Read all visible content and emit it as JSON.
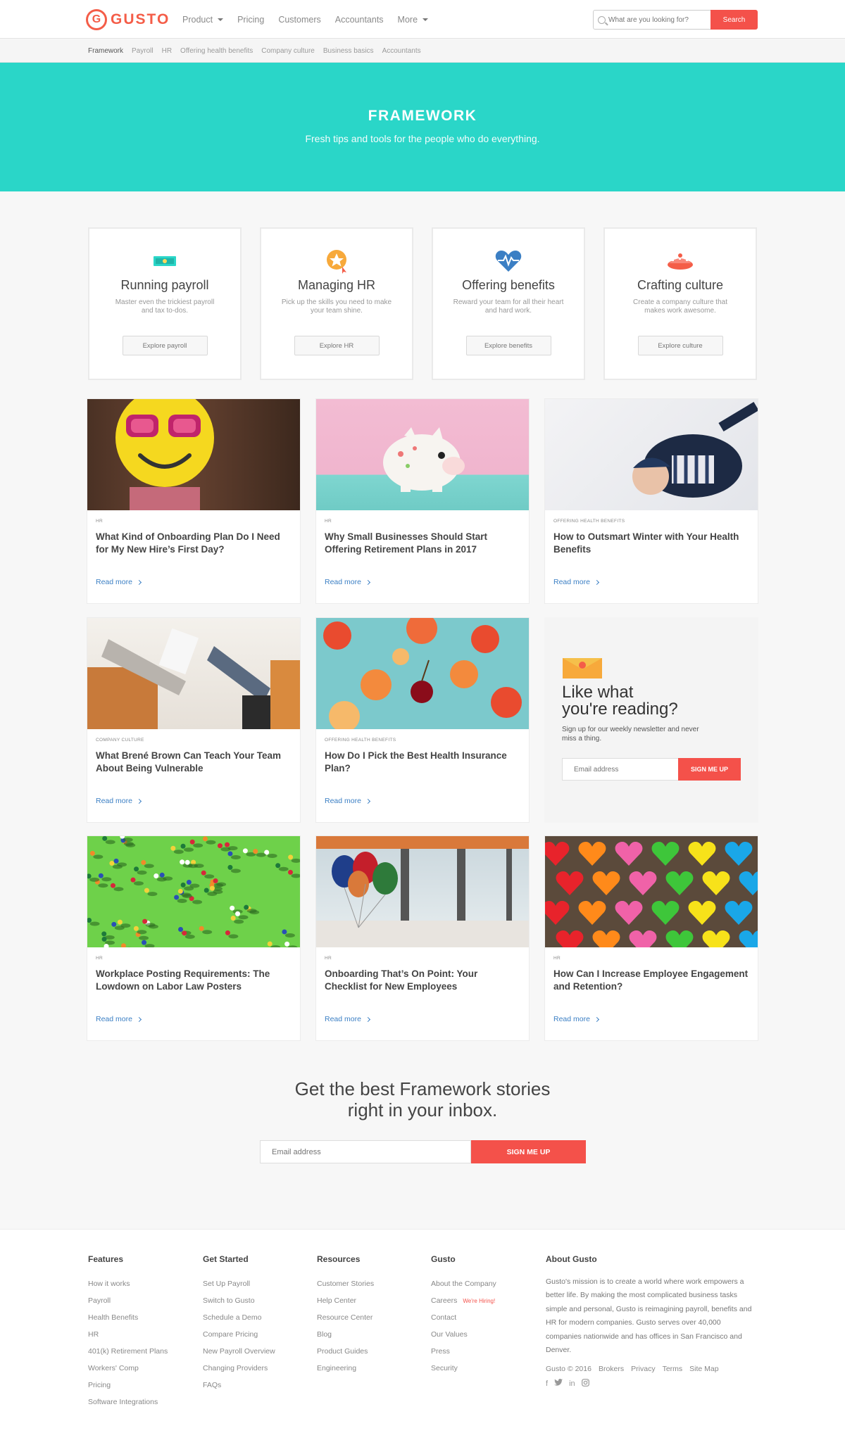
{
  "nav": {
    "logo": "GUSTO",
    "logo_mark": "G",
    "links": [
      "Product",
      "Pricing",
      "Customers",
      "Accountants",
      "More"
    ],
    "search_placeholder": "What are you looking for?",
    "search_button": "Search"
  },
  "subnav": [
    "Framework",
    "Payroll",
    "HR",
    "Offering health benefits",
    "Company culture",
    "Business basics",
    "Accountants"
  ],
  "hero": {
    "title": "FRAMEWORK",
    "subtitle": "Fresh tips and tools for the people who do everything."
  },
  "categories": [
    {
      "title": "Running payroll",
      "desc": "Master even the trickiest payroll and tax to-dos.",
      "button": "Explore payroll",
      "icon": "money-icon"
    },
    {
      "title": "Managing HR",
      "desc": "Pick up the skills you need to make your team shine.",
      "button": "Explore HR",
      "icon": "star-badge-icon"
    },
    {
      "title": "Offering benefits",
      "desc": "Reward your team for all their heart and hard work.",
      "button": "Explore benefits",
      "icon": "heart-pulse-icon"
    },
    {
      "title": "Crafting culture",
      "desc": "Create a company culture that makes work awesome.",
      "button": "Explore culture",
      "icon": "pie-icon"
    }
  ],
  "articles": [
    {
      "tag": "HR",
      "title": "What Kind of Onboarding Plan Do I Need for My New Hire’s First Day?",
      "more": "Read more"
    },
    {
      "tag": "HR",
      "title": "Why Small Businesses Should Start Offering Retirement Plans in 2017",
      "more": "Read more"
    },
    {
      "tag": "Offering health benefits",
      "title": "How to Outsmart Winter with Your Health Benefits",
      "more": "Read more"
    },
    {
      "tag": "Company culture",
      "title": "What Brené Brown Can Teach Your Team About Being Vulnerable",
      "more": "Read more"
    },
    {
      "tag": "Offering health benefits",
      "title": "How Do I Pick the Best Health Insurance Plan?",
      "more": "Read more"
    },
    {
      "tag": "HR",
      "title": "Workplace Posting Requirements: The Lowdown on Labor Law Posters",
      "more": "Read more"
    },
    {
      "tag": "HR",
      "title": "Onboarding That’s On Point: Your Checklist for New Employees",
      "more": "Read more"
    },
    {
      "tag": "HR",
      "title": "How Can I Increase Employee Engagement and Retention?",
      "more": "Read more"
    }
  ],
  "newsletter_card": {
    "title_line1": "Like what",
    "title_line2": "you're reading?",
    "subtitle": "Sign up for our weekly newsletter and never miss a thing.",
    "placeholder": "Email address",
    "button": "SIGN ME UP"
  },
  "bottom_signup": {
    "title_line1": "Get the best Framework stories",
    "title_line2": "right in your inbox.",
    "placeholder": "Email address",
    "button": "SIGN ME UP"
  },
  "footer": {
    "columns": [
      {
        "head": "Features",
        "links": [
          "How it works",
          "Payroll",
          "Health Benefits",
          "HR",
          "401(k) Retirement Plans",
          "Workers' Comp",
          "Pricing",
          "Software Integrations"
        ]
      },
      {
        "head": "Get Started",
        "links": [
          "Set Up Payroll",
          "Switch to Gusto",
          "Schedule a Demo",
          "Compare Pricing",
          "New Payroll Overview",
          "Changing Providers",
          "FAQs"
        ]
      },
      {
        "head": "Resources",
        "links": [
          "Customer Stories",
          "Help Center",
          "Resource Center",
          "Blog",
          "Product Guides",
          "Engineering"
        ]
      },
      {
        "head": "Gusto",
        "links": [
          "About the Company",
          "Careers",
          "Contact",
          "Our Values",
          "Press",
          "Security"
        ]
      }
    ],
    "hiring_badge": "We're Hiring!",
    "about_head": "About Gusto",
    "about_text": "Gusto's mission is to create a world where work empowers a better life. By making the most complicated business tasks simple and personal, Gusto is reimagining payroll, benefits and HR for modern companies. Gusto serves over 40,000 companies nationwide and has offices in San Francisco and Denver.",
    "copyright": "Gusto © 2016",
    "legal_links": [
      "Brokers",
      "Privacy",
      "Terms",
      "Site Map"
    ],
    "social": [
      "f",
      "t",
      "in",
      "ig"
    ]
  },
  "colors": {
    "brand": "#f45d48",
    "hero": "#2ad6c8",
    "button": "#f4514a",
    "link": "#3b7fc4"
  }
}
